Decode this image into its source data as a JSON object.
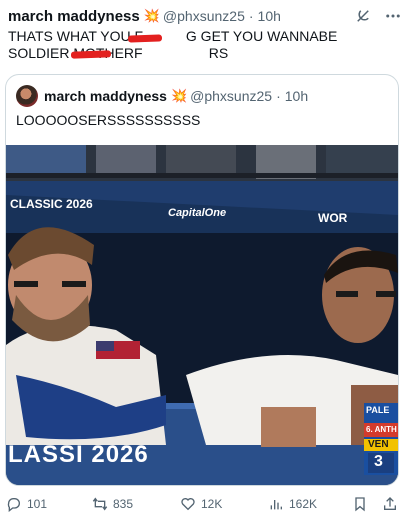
{
  "tweet": {
    "author_name": "march maddyness",
    "author_emoji": "💥",
    "handle": "@phxsunz25",
    "separator": "·",
    "time": "10h",
    "text": "THATS WHAT YOU F      G GET YOU WANNABE SOLDIER MOTHERF         RS"
  },
  "quoted": {
    "author_name": "march maddyness",
    "author_emoji": "💥",
    "handle": "@phxsunz25",
    "separator": "·",
    "time": "10h",
    "text": "LOOOOOSERSSSSSSSSSS"
  },
  "photo_text": {
    "banner_left": "CLASSIC 2026",
    "banner_sponsor": "CapitalOne",
    "banner_right": "WOR",
    "bottom_banner": "LASSI 2026",
    "sign_line1": "PALE",
    "sign_line2": "6. ANTH",
    "sign_line3": "VEN",
    "sign_line4": "3"
  },
  "actions": {
    "replies": "101",
    "reposts": "835",
    "likes": "12K",
    "views": "162K"
  },
  "colors": {
    "accent": "#1d9bf0",
    "muted": "#536471",
    "border": "#cfd9de",
    "redact": "#e3201f"
  },
  "icons": [
    "grok-icon",
    "more-icon",
    "reply-icon",
    "repost-icon",
    "like-icon",
    "views-icon",
    "bookmark-icon",
    "share-icon"
  ]
}
